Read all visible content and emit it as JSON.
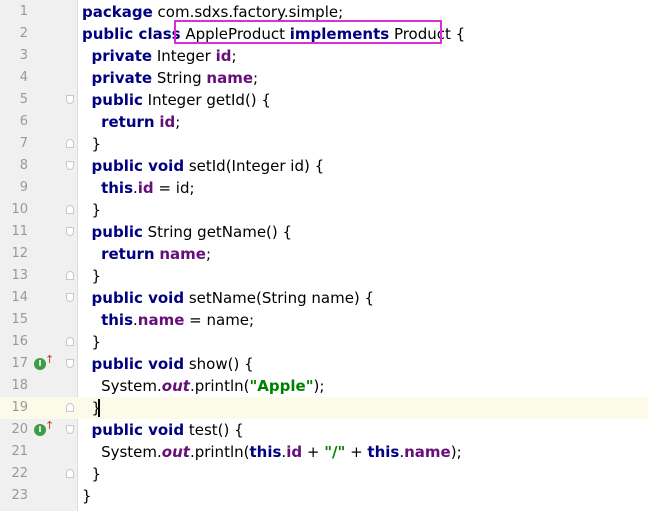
{
  "editor": {
    "lines": [
      {
        "number": "1",
        "tokens": [
          [
            "kw",
            "package"
          ],
          [
            "t",
            " com.sdxs.factory.simple;"
          ]
        ]
      },
      {
        "number": "2",
        "tokens": [
          [
            "kw",
            "public class"
          ],
          [
            "t",
            " AppleProduct "
          ],
          [
            "kw",
            "implements"
          ],
          [
            "t",
            " Product {"
          ]
        ]
      },
      {
        "number": "3",
        "tokens": [
          [
            "t",
            "  "
          ],
          [
            "kw",
            "private"
          ],
          [
            "t",
            " Integer "
          ],
          [
            "field",
            "id"
          ],
          [
            "t",
            ";"
          ]
        ]
      },
      {
        "number": "4",
        "tokens": [
          [
            "t",
            "  "
          ],
          [
            "kw",
            "private"
          ],
          [
            "t",
            " String "
          ],
          [
            "field",
            "name"
          ],
          [
            "t",
            ";"
          ]
        ]
      },
      {
        "number": "5",
        "tokens": [
          [
            "t",
            "  "
          ],
          [
            "kw",
            "public"
          ],
          [
            "t",
            " Integer getId() {"
          ]
        ]
      },
      {
        "number": "6",
        "tokens": [
          [
            "t",
            "    "
          ],
          [
            "kw",
            "return"
          ],
          [
            "t",
            " "
          ],
          [
            "field",
            "id"
          ],
          [
            "t",
            ";"
          ]
        ]
      },
      {
        "number": "7",
        "tokens": [
          [
            "t",
            "  }"
          ]
        ]
      },
      {
        "number": "8",
        "tokens": [
          [
            "t",
            "  "
          ],
          [
            "kw",
            "public void"
          ],
          [
            "t",
            " setId(Integer id) {"
          ]
        ]
      },
      {
        "number": "9",
        "tokens": [
          [
            "t",
            "    "
          ],
          [
            "kw",
            "this"
          ],
          [
            "t",
            "."
          ],
          [
            "field",
            "id"
          ],
          [
            "t",
            " = id;"
          ]
        ]
      },
      {
        "number": "10",
        "tokens": [
          [
            "t",
            "  }"
          ]
        ]
      },
      {
        "number": "11",
        "tokens": [
          [
            "t",
            "  "
          ],
          [
            "kw",
            "public"
          ],
          [
            "t",
            " String getName() {"
          ]
        ]
      },
      {
        "number": "12",
        "tokens": [
          [
            "t",
            "    "
          ],
          [
            "kw",
            "return"
          ],
          [
            "t",
            " "
          ],
          [
            "field",
            "name"
          ],
          [
            "t",
            ";"
          ]
        ]
      },
      {
        "number": "13",
        "tokens": [
          [
            "t",
            "  }"
          ]
        ]
      },
      {
        "number": "14",
        "tokens": [
          [
            "t",
            "  "
          ],
          [
            "kw",
            "public void"
          ],
          [
            "t",
            " setName(String name) {"
          ]
        ]
      },
      {
        "number": "15",
        "tokens": [
          [
            "t",
            "    "
          ],
          [
            "kw",
            "this"
          ],
          [
            "t",
            "."
          ],
          [
            "field",
            "name"
          ],
          [
            "t",
            " = name;"
          ]
        ]
      },
      {
        "number": "16",
        "tokens": [
          [
            "t",
            "  }"
          ]
        ]
      },
      {
        "number": "17",
        "tokens": [
          [
            "t",
            "  "
          ],
          [
            "kw",
            "public void"
          ],
          [
            "t",
            " show() {"
          ]
        ]
      },
      {
        "number": "18",
        "tokens": [
          [
            "t",
            "    System."
          ],
          [
            "static",
            "out"
          ],
          [
            "t",
            ".println("
          ],
          [
            "str",
            "\"Apple\""
          ],
          [
            "t",
            ");"
          ]
        ]
      },
      {
        "number": "19",
        "tokens": [
          [
            "t",
            "  }"
          ]
        ]
      },
      {
        "number": "20",
        "tokens": [
          [
            "t",
            "  "
          ],
          [
            "kw",
            "public void"
          ],
          [
            "t",
            " test() {"
          ]
        ]
      },
      {
        "number": "21",
        "tokens": [
          [
            "t",
            "    System."
          ],
          [
            "static",
            "out"
          ],
          [
            "t",
            ".println("
          ],
          [
            "kw",
            "this"
          ],
          [
            "t",
            "."
          ],
          [
            "field",
            "id"
          ],
          [
            "t",
            " + "
          ],
          [
            "str",
            "\"/\""
          ],
          [
            "t",
            " + "
          ],
          [
            "kw",
            "this"
          ],
          [
            "t",
            "."
          ],
          [
            "field",
            "name"
          ],
          [
            "t",
            ");"
          ]
        ]
      },
      {
        "number": "22",
        "tokens": [
          [
            "t",
            "  }"
          ]
        ]
      },
      {
        "number": "23",
        "tokens": [
          [
            "t",
            "}"
          ]
        ]
      }
    ],
    "fold_start_lines": [
      "5",
      "8",
      "11",
      "14",
      "17",
      "20"
    ],
    "fold_end_lines": [
      "7",
      "10",
      "13",
      "16",
      "19",
      "22"
    ],
    "implements_marker_lines": [
      "17",
      "20"
    ],
    "implements_marker_glyph": "I",
    "implements_arrow_glyph": "↑",
    "current_line": "19"
  },
  "colors": {
    "keyword": "#000080",
    "field": "#660e7a",
    "string": "#008000",
    "highlight_box": "#d631d6",
    "current_line_bg": "#fcfae9"
  },
  "icons": {
    "fold": "fold-marker-icon",
    "implements": "implements-method-icon"
  }
}
